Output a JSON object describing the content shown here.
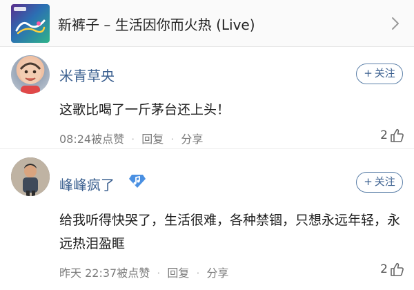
{
  "song": {
    "title": "新裤子 – 生活因你而火热 (Live)",
    "cover_icon": "album-cover",
    "chevron_icon": "chevron-right-icon"
  },
  "comments": [
    {
      "username": "米青草央",
      "follow_label": "关注",
      "follow_plus": "+",
      "content": "这歌比喝了一斤茅台还上头！",
      "time": "08:24",
      "liked_text": "被点赞",
      "sep": "·",
      "reply_label": "回复",
      "share_label": "分享",
      "like_count": "2"
    },
    {
      "username": "峰峰疯了",
      "follow_label": "关注",
      "follow_plus": "+",
      "content": "给我听得快哭了，生活很难，各种禁锢，只想永远年轻，永远热泪盈眶",
      "time": "昨天 22:37",
      "liked_text": "被点赞",
      "sep": "·",
      "reply_label": "回复",
      "share_label": "分享",
      "like_count": "2"
    }
  ],
  "colors": {
    "username": "#3a5f8f",
    "follow_border": "#5b7fa8",
    "meta": "#7b7b7b",
    "vip_badge": "#4a90e2"
  }
}
